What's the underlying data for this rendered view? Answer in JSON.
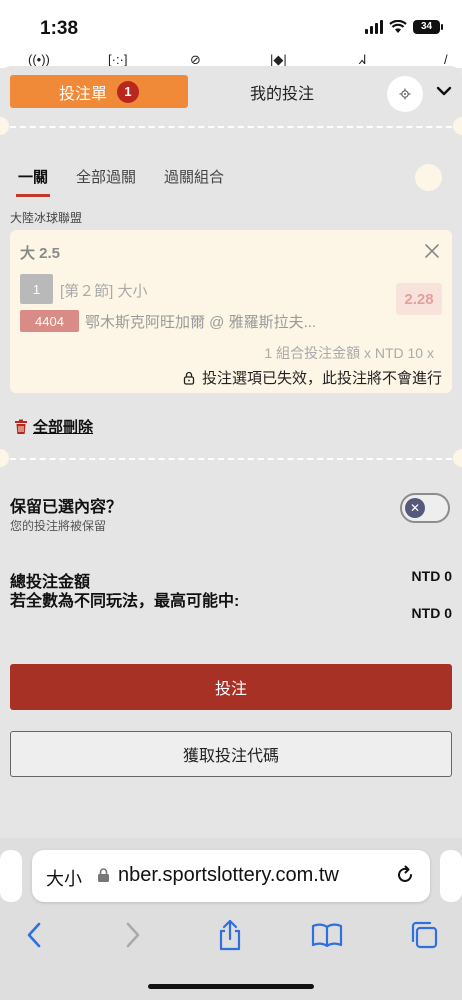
{
  "status_bar": {
    "time": "1:38",
    "battery": "34"
  },
  "header": {
    "betslip_tab_label": "投注單",
    "betslip_count": "1",
    "mybets_tab_label": "我的投注",
    "settings_icon": "gear-icon",
    "collapse_icon": "chevron-down-icon"
  },
  "subtabs": [
    {
      "label": "一關",
      "active": true
    },
    {
      "label": "全部過關",
      "active": false
    },
    {
      "label": "過關組合",
      "active": false
    }
  ],
  "league": "大陸冰球聯盟",
  "bet": {
    "selection": "大 2.5",
    "period_number": "1",
    "market": "[第２節] 大小",
    "odds": "2.28",
    "event_code": "4404",
    "event_name": "鄂木斯克阿旺加爾 @ 雅羅斯拉夫...",
    "stake_line": "1 組合投注金額 x NTD 10 x",
    "invalid_note": "投注選項已失效，此投注將不會進行"
  },
  "delete_all_label": "全部刪除",
  "keep_selections": {
    "title": "保留已選內容？",
    "subtitle": "您的投注將被保留",
    "enabled": false
  },
  "totals": {
    "total_stake_label": "總投注金額",
    "total_stake_value": "NTD 0",
    "max_win_label": "若全數為不同玩法，最高可能中:",
    "max_win_value": "NTD 0"
  },
  "buttons": {
    "place_bet": "投注",
    "get_code": "獲取投注代碼"
  },
  "browser": {
    "text_size_label": "大小",
    "url": "nber.sportslottery.com.tw"
  },
  "colors": {
    "accent_orange": "#f08a38",
    "brand_red": "#a83126",
    "badge_red": "#b8261e"
  }
}
